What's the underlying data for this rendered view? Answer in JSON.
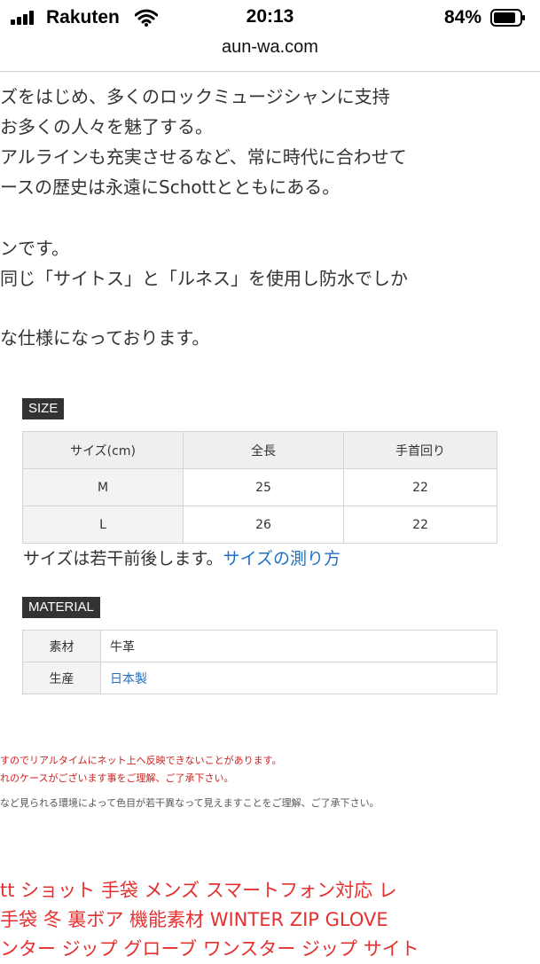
{
  "status": {
    "carrier": "Rakuten",
    "time": "20:13",
    "battery": "84%"
  },
  "browser": {
    "url": "aun-wa.com"
  },
  "description": [
    "ズをはじめ、多くのロックミュージシャンに支持",
    "お多くの人々を魅了する。",
    "アルラインも充実させるなど、常に時代に合わせて",
    "ースの歴史は永遠にSchottとともにある。",
    "ンです。",
    "同じ「サイトス」と「ルネス」を使用し防水でしか",
    "な仕様になっております。"
  ],
  "size": {
    "label": "SIZE",
    "headers": [
      "サイズ(cm)",
      "全長",
      "手首回り"
    ],
    "rows": [
      [
        "M",
        "25",
        "22"
      ],
      [
        "L",
        "26",
        "22"
      ]
    ],
    "note": "サイズは若干前後します。",
    "link": "サイズの測り方"
  },
  "material": {
    "label": "MATERIAL",
    "rows": [
      {
        "key": "素材",
        "value": "牛革"
      },
      {
        "key": "生産",
        "value": "日本製"
      }
    ]
  },
  "notices": [
    "すのでリアルタイムにネット上へ反映できないことがあります。",
    "れのケースがございます事をご理解、ご了承下さい。",
    "など見られる環境によって色目が若干異なって見えますことをご理解、ご了承下さい。"
  ],
  "related": [
    "tt ショット 手袋 メンズ スマートフォン対応 レ",
    "手袋 冬 裏ボア 機能素材 WINTER ZIP GLOVE",
    "ンター ジップ グローブ ワンスター ジップ サイト"
  ]
}
